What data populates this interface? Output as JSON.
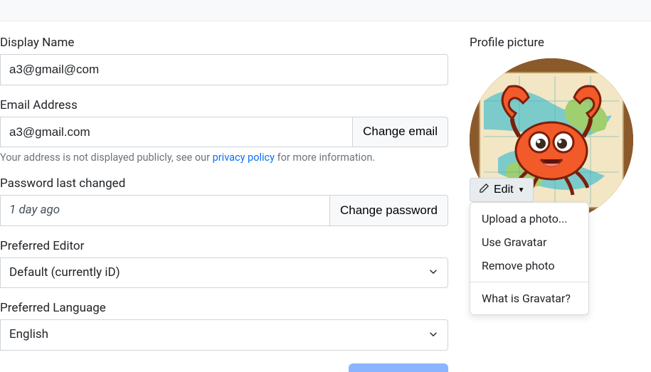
{
  "form": {
    "display_name": {
      "label": "Display Name",
      "value": "a3@gmail@com"
    },
    "email": {
      "label": "Email Address",
      "value": "a3@gmail.com",
      "change_button": "Change email",
      "hint_prefix": "Your address is not displayed publicly, see our ",
      "hint_link": "privacy policy",
      "hint_suffix": " for more information."
    },
    "password": {
      "label": "Password last changed",
      "value": "1 day ago",
      "change_button": "Change password"
    },
    "editor": {
      "label": "Preferred Editor",
      "value": "Default (currently iD)"
    },
    "language": {
      "label": "Preferred Language",
      "value": "English"
    }
  },
  "profile_picture": {
    "title": "Profile picture",
    "edit_button": "Edit",
    "menu": {
      "upload": "Upload a photo...",
      "gravatar": "Use Gravatar",
      "remove": "Remove photo",
      "what_is": "What is Gravatar?"
    }
  }
}
